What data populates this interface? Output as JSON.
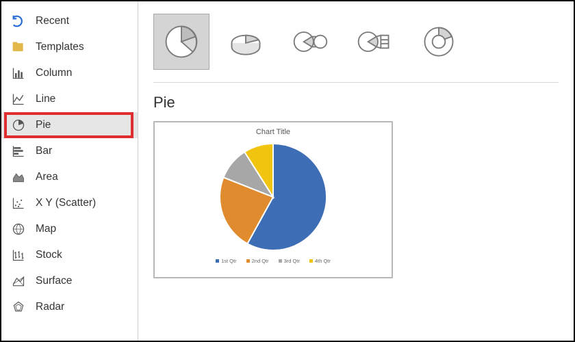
{
  "sidebar": {
    "items": [
      {
        "label": "Recent"
      },
      {
        "label": "Templates"
      },
      {
        "label": "Column"
      },
      {
        "label": "Line"
      },
      {
        "label": "Pie"
      },
      {
        "label": "Bar"
      },
      {
        "label": "Area"
      },
      {
        "label": "X Y (Scatter)"
      },
      {
        "label": "Map"
      },
      {
        "label": "Stock"
      },
      {
        "label": "Surface"
      },
      {
        "label": "Radar"
      }
    ],
    "selected_index": 4
  },
  "subtypes": {
    "names": [
      "pie",
      "3d-pie",
      "pie-of-pie",
      "bar-of-pie",
      "doughnut"
    ],
    "selected_index": 0
  },
  "section_title": "Pie",
  "preview": {
    "chart_title": "Chart Title",
    "legend": [
      "1st Qtr",
      "2nd Qtr",
      "3rd Qtr",
      "4th Qtr"
    ]
  },
  "chart_data": {
    "type": "pie",
    "title": "Chart Title",
    "categories": [
      "1st Qtr",
      "2nd Qtr",
      "3rd Qtr",
      "4th Qtr"
    ],
    "values": [
      58,
      23,
      10,
      9
    ],
    "colors": [
      "#3d6db5",
      "#e08b2e",
      "#a7a7a7",
      "#f1c40f"
    ]
  }
}
